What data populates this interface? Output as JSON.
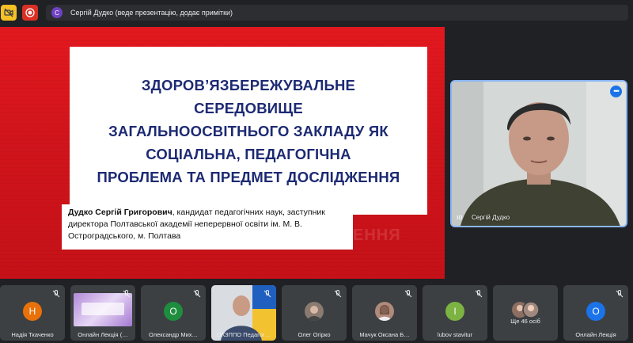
{
  "topbar": {
    "presenter_initial": "С",
    "presenter_text": "Сергій Дудко (веде презентацію, додає примітки)"
  },
  "slide": {
    "title": "ЗДОРОВ’ЯЗБЕРЕЖУВАЛЬНЕ\nСЕРЕДОВИЩЕ\nЗАГАЛЬНООСВІТНЬОГО ЗАКЛАДУ ЯК\nСОЦІАЛЬНА, ПЕДАГОГІЧНА\nПРОБЛЕМА ТА ПРЕДМЕТ ДОСЛІДЖЕННЯ",
    "author_name": "Дудко Сергій Григорович",
    "author_details": ", кандидат педагогічних наук, заступник директора Полтавської академії неперервної освіти ім. М. В. Остроградського, м. Полтава",
    "watermark": "ЕННЯ"
  },
  "speaker": {
    "name": "Сергій Дудко"
  },
  "participants": [
    {
      "initial": "Н",
      "name": "Надія Ткаченко",
      "color": "#e8710a"
    },
    {
      "initial": "",
      "name": "Онлайн Лекція (…",
      "color": ""
    },
    {
      "initial": "О",
      "name": "Олександр Мих…",
      "color": "#1e8e3e"
    },
    {
      "initial": "",
      "name": "ОКЗППО Педагог…",
      "color": ""
    },
    {
      "initial": "",
      "name": "Олег Огірко",
      "color": ""
    },
    {
      "initial": "",
      "name": "Мачук Оксана Б…",
      "color": ""
    },
    {
      "initial": "I",
      "name": "lubov stavitur",
      "color": "#7cb342"
    },
    {
      "initial": "",
      "name": "Ще 46 осіб",
      "color": ""
    },
    {
      "initial": "О",
      "name": "Онлайн Лекція",
      "color": "#1a73e8"
    }
  ]
}
